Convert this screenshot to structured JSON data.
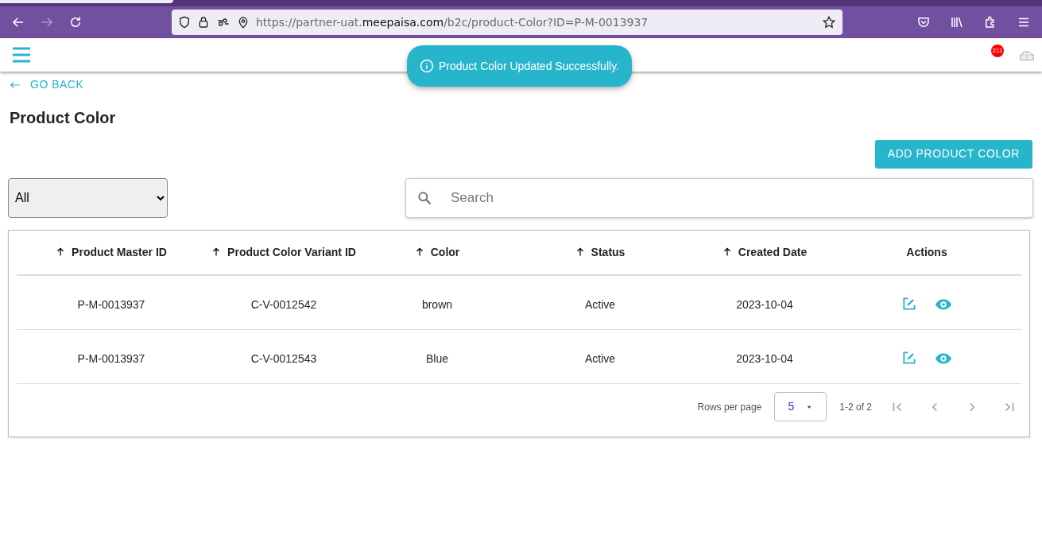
{
  "browser": {
    "back_disabled": false,
    "forward_disabled": true,
    "url": {
      "prefix": "https://partner-uat.",
      "domain": "meepaisa.com",
      "path": "/b2c/product-Color?ID=P-M-0013937"
    }
  },
  "header": {
    "notification_count": "211"
  },
  "toast": {
    "message": "Product Color Updated Successfully."
  },
  "go_back": "GO BACK",
  "title": "Product Color",
  "add_button": "ADD PRODUCT COLOR",
  "filter": {
    "value": "All"
  },
  "search": {
    "placeholder": "Search"
  },
  "table": {
    "columns": [
      {
        "label": "Product Master ID",
        "sortable": true
      },
      {
        "label": "Product Color Variant ID",
        "sortable": true
      },
      {
        "label": "Color",
        "sortable": true
      },
      {
        "label": "Status",
        "sortable": true
      },
      {
        "label": "Created Date",
        "sortable": true
      },
      {
        "label": "Actions",
        "sortable": false
      }
    ],
    "rows": [
      [
        "P-M-0013937",
        "C-V-0012542",
        "brown",
        "Active",
        "2023-10-04"
      ],
      [
        "P-M-0013937",
        "C-V-0012543",
        "Blue",
        "Active",
        "2023-10-04"
      ]
    ]
  },
  "pagination": {
    "rows_per_page_label": "Rows per page",
    "rows_per_page": "5",
    "range": "1-2 of 2",
    "buttons": [
      {
        "kind": "first",
        "disabled": true
      },
      {
        "kind": "prev",
        "disabled": true
      },
      {
        "kind": "next",
        "disabled": true
      },
      {
        "kind": "last",
        "disabled": true
      }
    ]
  }
}
